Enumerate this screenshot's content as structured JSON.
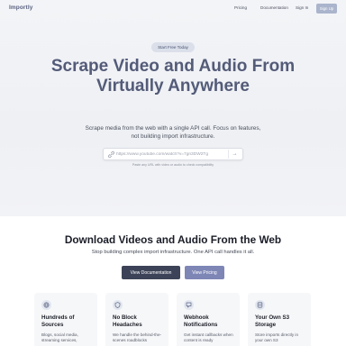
{
  "nav": {
    "logo": "Importly",
    "links": [
      "Pricing",
      "Documentation",
      "Sign In"
    ],
    "signup": "Sign Up"
  },
  "hero": {
    "badge": "Start Free Today",
    "headline": "Scrape Video and Audio From Virtually Anywhere",
    "subtitle": "Scrape media from the web with a single API call. Focus on features, not building import infrastructure.",
    "search_placeholder": "https://www.youtube.com/watch?v=7gn3DW2Tg",
    "hint": "Paste any URL with video or audio to check compatibility"
  },
  "section": {
    "title": "Download Videos and Audio From the Web",
    "subtitle": "Stop building complex import infrastructure. One API call handles it all.",
    "btn_docs": "View Documentation",
    "btn_pricing": "View Pricing"
  },
  "cards": [
    {
      "icon": "globe-icon",
      "title": "Hundreds of Sources",
      "desc": "Blogs, social media, streaming services,"
    },
    {
      "icon": "shield-icon",
      "title": "No Block Headaches",
      "desc": "We handle the behind-the-scenes roadblocks"
    },
    {
      "icon": "webhook-icon",
      "title": "Webhook Notifications",
      "desc": "Get instant callbacks when content is ready"
    },
    {
      "icon": "database-icon",
      "title": "Your Own S3 Storage",
      "desc": "Store imports directly in your own S3"
    }
  ]
}
